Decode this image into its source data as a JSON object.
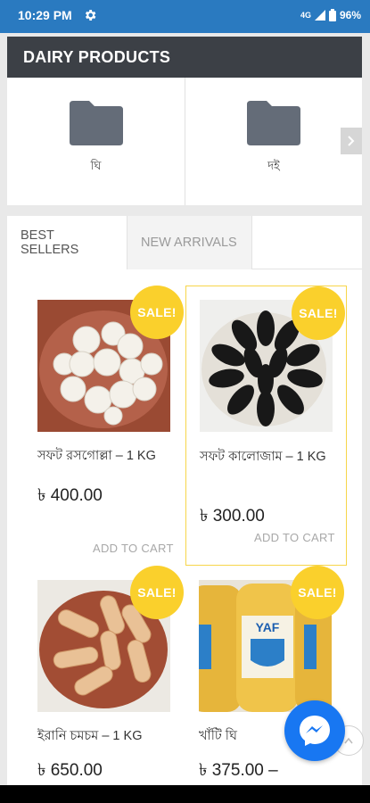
{
  "status_bar": {
    "time": "10:29 PM",
    "battery": "96%",
    "signal": "4G"
  },
  "category": {
    "header": "DAIRY PRODUCTS",
    "items": [
      {
        "label": "ঘি",
        "icon": "folder-icon"
      },
      {
        "label": "দই",
        "icon": "folder-icon"
      }
    ]
  },
  "tabs": [
    {
      "label": "BEST SELLERS",
      "active": true
    },
    {
      "label": "NEW ARRIVALS",
      "active": false
    }
  ],
  "products": [
    {
      "title": "সফট রসগোল্লা – 1 KG",
      "price": "৳ 400.00",
      "cart": "ADD TO CART",
      "sale": "SALE!"
    },
    {
      "title": "সফট কালোজাম – 1 KG",
      "price": "৳ 300.00",
      "cart": "ADD TO CART",
      "sale": "SALE!"
    },
    {
      "title": "ইরানি চমচম – 1 KG",
      "price": "৳ 650.00",
      "sale": "SALE!"
    },
    {
      "title": "খাঁটি ঘি",
      "price": "৳ 375.00 –",
      "sale": "SALE!"
    }
  ],
  "colors": {
    "accent": "#2a7ac0",
    "sale": "#fad02c",
    "header": "#3c4046",
    "messenger": "#1877f2"
  }
}
